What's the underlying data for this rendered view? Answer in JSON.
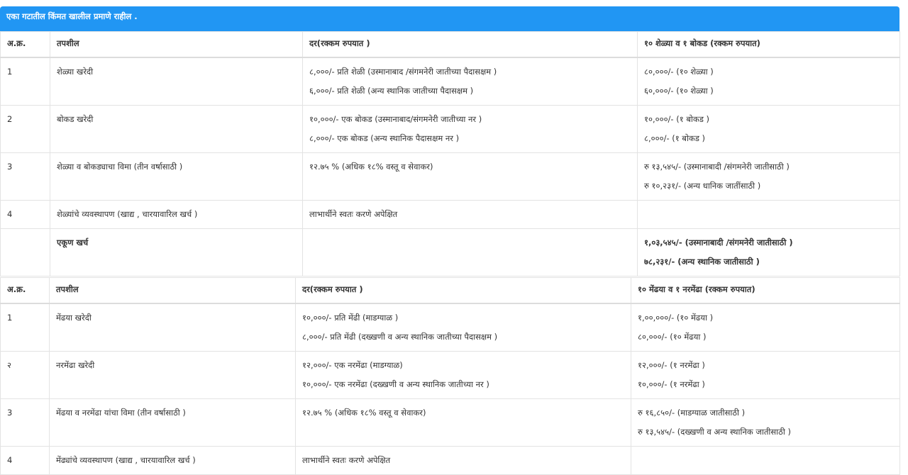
{
  "banner": "एका गटातील किंमत खालील प्रमाणे राहील .",
  "table1": {
    "headers": [
      "अ.क्र.",
      "तपशील",
      "दर(रक्कम रुपयात )",
      "१० शेळ्या व १ बोकड (रक्कम रुपयात)"
    ],
    "rows": [
      {
        "no": "1",
        "item": "शेळ्या खरेदी",
        "rate": [
          "८,०००/- प्रति शेळी (उस्मानाबाद /संगमनेरी जातीच्या पैदासक्षम )",
          "६,०००/- प्रति शेळी (अन्य स्थानिक जातीच्या पैदासक्षम )"
        ],
        "amount": [
          "८०,०००/- (१० शेळ्या )",
          "६०,०००/- (१० शेळ्या )"
        ]
      },
      {
        "no": "2",
        "item": "बोकड खरेदी",
        "rate": [
          "१०,०००/- एक बोकड (उस्मानाबाद/संगमनेरी जातीच्या नर )",
          "८,०००/- एक बोकड (अन्य स्थानिक पैदासक्षम नर )"
        ],
        "amount": [
          "१०,०००/- (१ बोकड )",
          "८,०००/- (१ बोकड )"
        ]
      },
      {
        "no": "3",
        "item": "शेळ्या व बोकड्याचा विमा (तीन वर्षासाठी )",
        "rate": [
          "१२.७५ % (अधिक १८% वस्तू व सेवाकर)"
        ],
        "amount": [
          "रु १३,५४५/- (उस्मानाबादी /संगमनेरी जातीसाठी )",
          "रु १०,२३१/- (अन्य धानिक जातींसाठी )"
        ]
      },
      {
        "no": "4",
        "item": "शेळ्यांचे व्यवस्थापण (खाद्य , चारयावारिल खर्च )",
        "rate": [
          "लाभार्थीने स्वतः करणे अपेक्षित"
        ],
        "amount": []
      }
    ],
    "total": {
      "label": "एकूण खर्च",
      "amount": [
        "१,०३,५४५/- (उस्मानाबादी /संगमनेरी जातीसाठी )",
        "७८,२३१/- (अन्य स्थानिक जातीसाठी )"
      ]
    }
  },
  "table2": {
    "headers": [
      "अ.क्र.",
      "तपशील",
      "दर(रक्कम रुपयात )",
      "१० मेंढया व १ नरमेंढा (रक्कम रुपयात)"
    ],
    "rows": [
      {
        "no": "1",
        "item": "मेंढया खरेदी",
        "rate": [
          "१०,०००/- प्रति मेंढी (माडग्याळ )",
          "८,०००/- प्रति मेंढी (दख्खणी व अन्य स्थानिक जातीच्या पैदासक्षम )"
        ],
        "amount": [
          "१,००,०००/- (१० मेंढया )",
          "८०,०००/- (१० मेंढया )"
        ]
      },
      {
        "no": "२",
        "item": "नरमेंढा खरेदी",
        "rate": [
          "१२,०००/- एक नरमेंढा (माडग्याळ)",
          "१०,०००/- एक नरमेंढा (दख्खणी व अन्य स्थानिक जातीच्या नर )"
        ],
        "amount": [
          "१२,०००/- (१ नरमेंढा )",
          "१०,०००/- (१ नरमेंढा )"
        ]
      },
      {
        "no": "3",
        "item": "मेंढया व नरमेंढा यांचा विमा (तीन वर्षासाठी )",
        "rate": [
          "१२.७५ % (अधिक १८% वस्तू व सेवाकर)"
        ],
        "amount": [
          "रु १६,८५०/- (माडग्याळ जातीसाठी )",
          "रु १३,५४५/- (दख्खणी व अन्य स्थानिक जातीसाठी )"
        ]
      },
      {
        "no": "4",
        "item": "मेंढ्यांचे व्यवस्थापण (खाद्य , चारयावारिल खर्च )",
        "rate": [
          "लाभार्थीने स्वतः करणे अपेक्षित"
        ],
        "amount": []
      }
    ]
  },
  "colors": {
    "banner": "#2196f3",
    "border": "#e3e3e3",
    "text": "#333333"
  }
}
